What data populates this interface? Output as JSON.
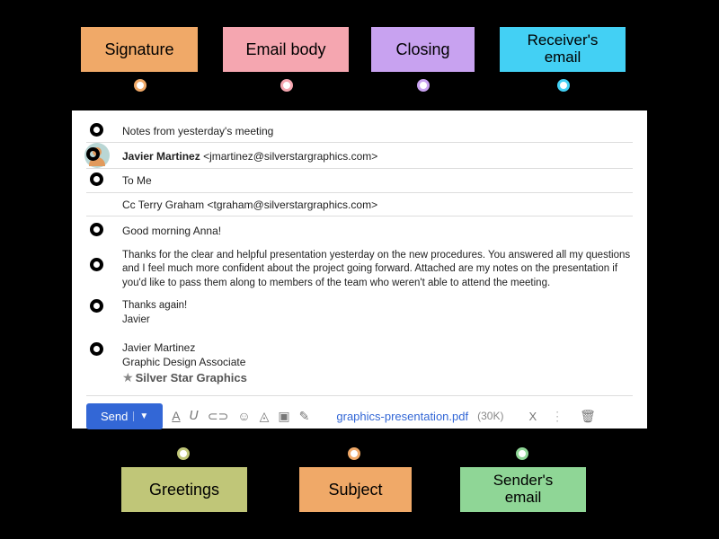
{
  "labels": {
    "signature": "Signature",
    "emailBody": "Email body",
    "closing": "Closing",
    "receiversEmail": "Receiver's email",
    "greetings": "Greetings",
    "subject": "Subject",
    "sendersEmail": "Sender's email"
  },
  "colors": {
    "signature": "#f0a968",
    "emailBody": "#f5a6b0",
    "closing": "#c8a2f0",
    "receiversEmail": "#43d0f4",
    "greetings": "#c0c678",
    "subject": "#f0a968",
    "sendersEmail": "#8fd696"
  },
  "email": {
    "subject": "Notes from yesterday's meeting",
    "from_name": "Javier Martinez",
    "from_email": "<jmartinez@silverstargraphics.com>",
    "to": "To Me",
    "cc_label": "Cc Terry Graham",
    "cc_email": "<tgraham@silverstargraphics.com>",
    "greeting": "Good morning Anna!",
    "body": "Thanks for the clear and helpful presentation yesterday on the new procedures. You answered all my questions and I feel much more confident about the project going forward. Attached are my notes on the presentation if you'd like to pass them along to members of the team who weren't able to attend the meeting.",
    "closing_line1": "Thanks again!",
    "closing_line2": "Javier",
    "sig_name": "Javier Martinez",
    "sig_title": "Graphic Design Associate",
    "sig_company": "Silver Star Graphics",
    "send": "Send",
    "attachment_name": "graphics-presentation.pdf",
    "attachment_size": "(30K)"
  }
}
